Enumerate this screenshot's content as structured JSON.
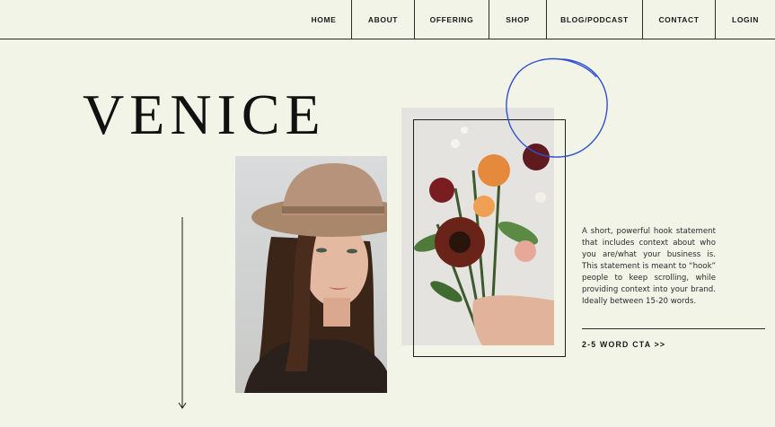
{
  "nav": {
    "items": [
      {
        "label": "HOME"
      },
      {
        "label": "ABOUT"
      },
      {
        "label": "OFFERING"
      },
      {
        "label": "SHOP"
      },
      {
        "label": "BLOG/PODCAST"
      },
      {
        "label": "CONTACT"
      },
      {
        "label": "LOGIN"
      }
    ]
  },
  "hero": {
    "brand": "VENICE",
    "hook": "A short, powerful hook statement that includes context about who you are/what your business is. This statement is meant to “hook” people to keep scrolling, while providing context into your brand. Ideally between 15-20 words.",
    "cta": "2-5 WORD CTA >>"
  },
  "colors": {
    "background": "#f2f4e8",
    "ink": "#1a1a1a",
    "accent_circle": "#2f4fd0"
  },
  "icons": {
    "scroll": "down-arrow-icon",
    "decor": "hand-drawn-circle"
  }
}
